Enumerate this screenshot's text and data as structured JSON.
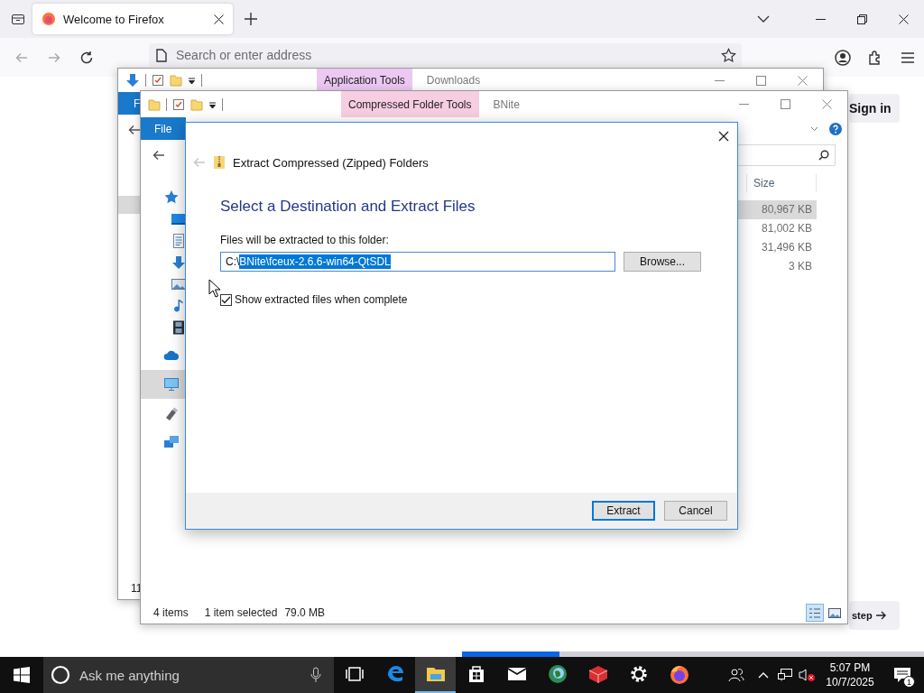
{
  "browser": {
    "tabs": [
      {
        "title": "Welcome to Firefox",
        "selected": true
      }
    ],
    "address_placeholder": "Search or enter address",
    "sign_in": "Sign in",
    "step_button": "step",
    "progress": {
      "level": 0.21
    }
  },
  "explorer_back": {
    "context_tab": "Application Tools",
    "title": "Downloads",
    "ribbon_tab": "F",
    "status_text": "11"
  },
  "explorer_front": {
    "context_tab": "Compressed Folder Tools",
    "title": "BNite",
    "ribbon_tab": "File",
    "nav_items": [
      {
        "kind": "quick-access",
        "selected": false,
        "children": [
          {
            "kind": "desktop",
            "selected": false
          },
          {
            "kind": "documents",
            "selected": false
          },
          {
            "kind": "downloads",
            "selected": false
          },
          {
            "kind": "pictures",
            "selected": false
          },
          {
            "kind": "music",
            "selected": false
          },
          {
            "kind": "videos",
            "selected": false
          }
        ]
      },
      {
        "kind": "cloud",
        "selected": false
      },
      {
        "kind": "computer",
        "selected": true
      },
      {
        "kind": "drive",
        "selected": false
      },
      {
        "kind": "network",
        "selected": false
      }
    ],
    "size_header": "Size",
    "files": [
      {
        "size": "80,967 KB",
        "selected": true
      },
      {
        "size": "81,002 KB",
        "selected": false
      },
      {
        "size": "31,496 KB",
        "selected": false
      },
      {
        "size": "3 KB",
        "selected": false
      }
    ],
    "status": {
      "items": "4 items",
      "selection": "1 item selected",
      "selection_size": "79.0 MB"
    },
    "views": [
      {
        "kind": "details",
        "selected": true
      },
      {
        "kind": "large-icons",
        "selected": false
      }
    ]
  },
  "dialog": {
    "title": "Extract Compressed (Zipped) Folders",
    "heading": "Select a Destination and Extract Files",
    "label": "Files will be extracted to this folder:",
    "path_parts": [
      {
        "text": "C:\\",
        "selected": false
      },
      {
        "text": "BNite\\fceux-2.6.6-win64-QtSDL",
        "selected": true
      }
    ],
    "browse": "Browse...",
    "show_files": {
      "label": "Show extracted files when complete",
      "checked": true
    },
    "buttons": [
      {
        "label": "Extract",
        "default": true
      },
      {
        "label": "Cancel",
        "default": false
      }
    ]
  },
  "taskbar": {
    "search_placeholder": "Ask me anything",
    "apps": [
      {
        "kind": "task-view",
        "selected": false
      },
      {
        "kind": "edge",
        "selected": false
      },
      {
        "kind": "explorer",
        "selected": true
      },
      {
        "kind": "store",
        "selected": false
      },
      {
        "kind": "mail",
        "selected": false
      },
      {
        "kind": "globe",
        "selected": false
      },
      {
        "kind": "red-app",
        "selected": false
      },
      {
        "kind": "settings",
        "selected": false
      },
      {
        "kind": "firefox",
        "selected": false
      }
    ],
    "time": "5:07 PM",
    "date": "10/7/2025",
    "notifications": "1"
  }
}
